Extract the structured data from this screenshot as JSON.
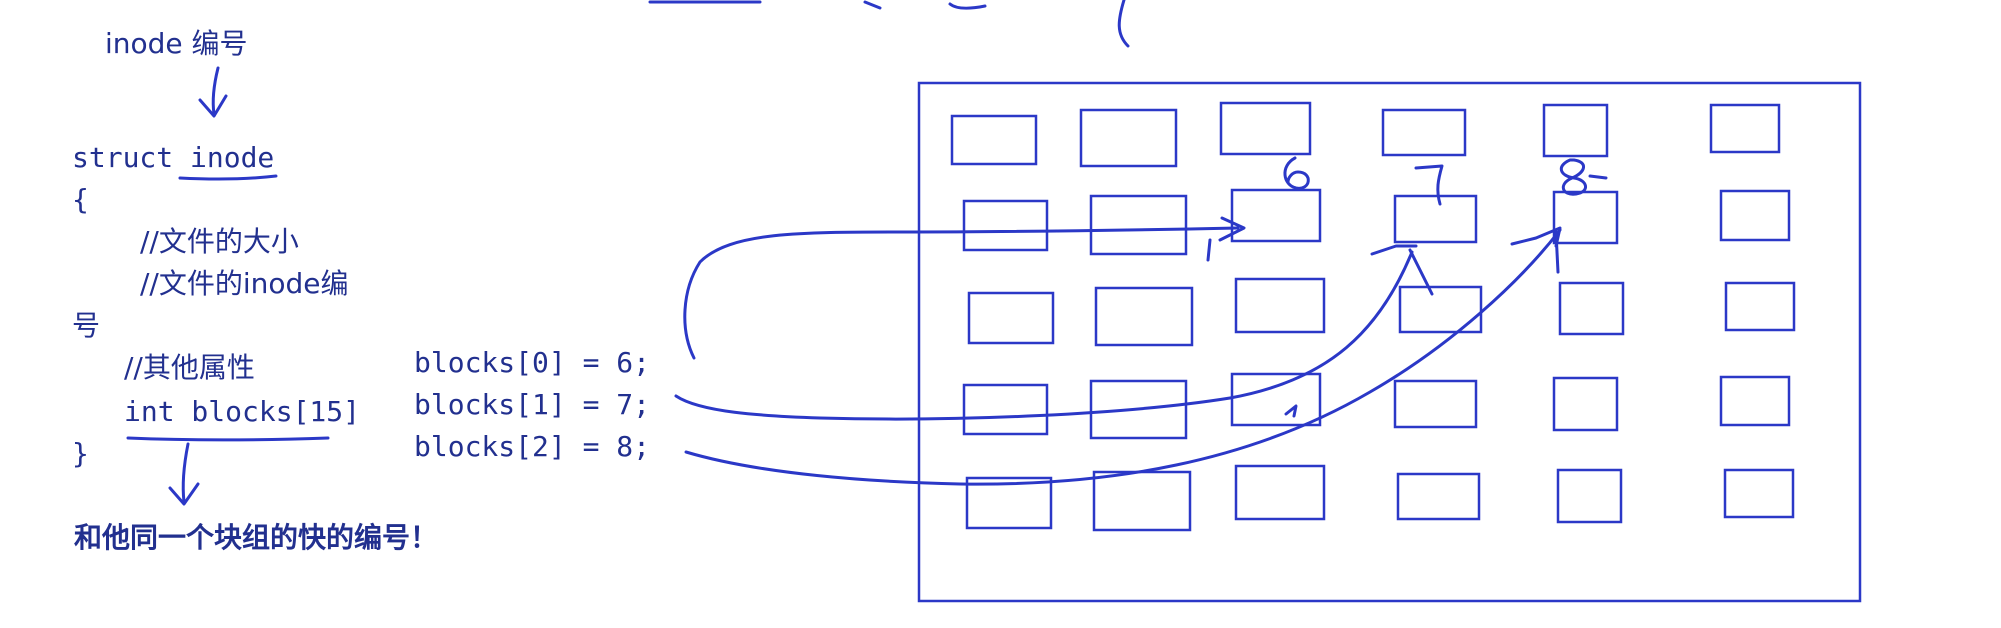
{
  "inode_caption": "inode 编号",
  "struct_code": {
    "decl": "struct inode",
    "open": "{",
    "comment_size": "//文件的大小",
    "comment_inode_1": "//文件的inode编",
    "comment_inode_2": "号",
    "comment_other": "//其他属性",
    "field": "int blocks[15]",
    "close": "}"
  },
  "conclusion": "和他同一个块组的快的编号！",
  "assignments": [
    "blocks[0] = 6;",
    "blocks[1] = 7;",
    "blocks[2] = 8;"
  ],
  "handwritten_digits": [
    "6",
    "7",
    "8"
  ],
  "ink_color": "#2b38c7",
  "text_color": "#22308f"
}
